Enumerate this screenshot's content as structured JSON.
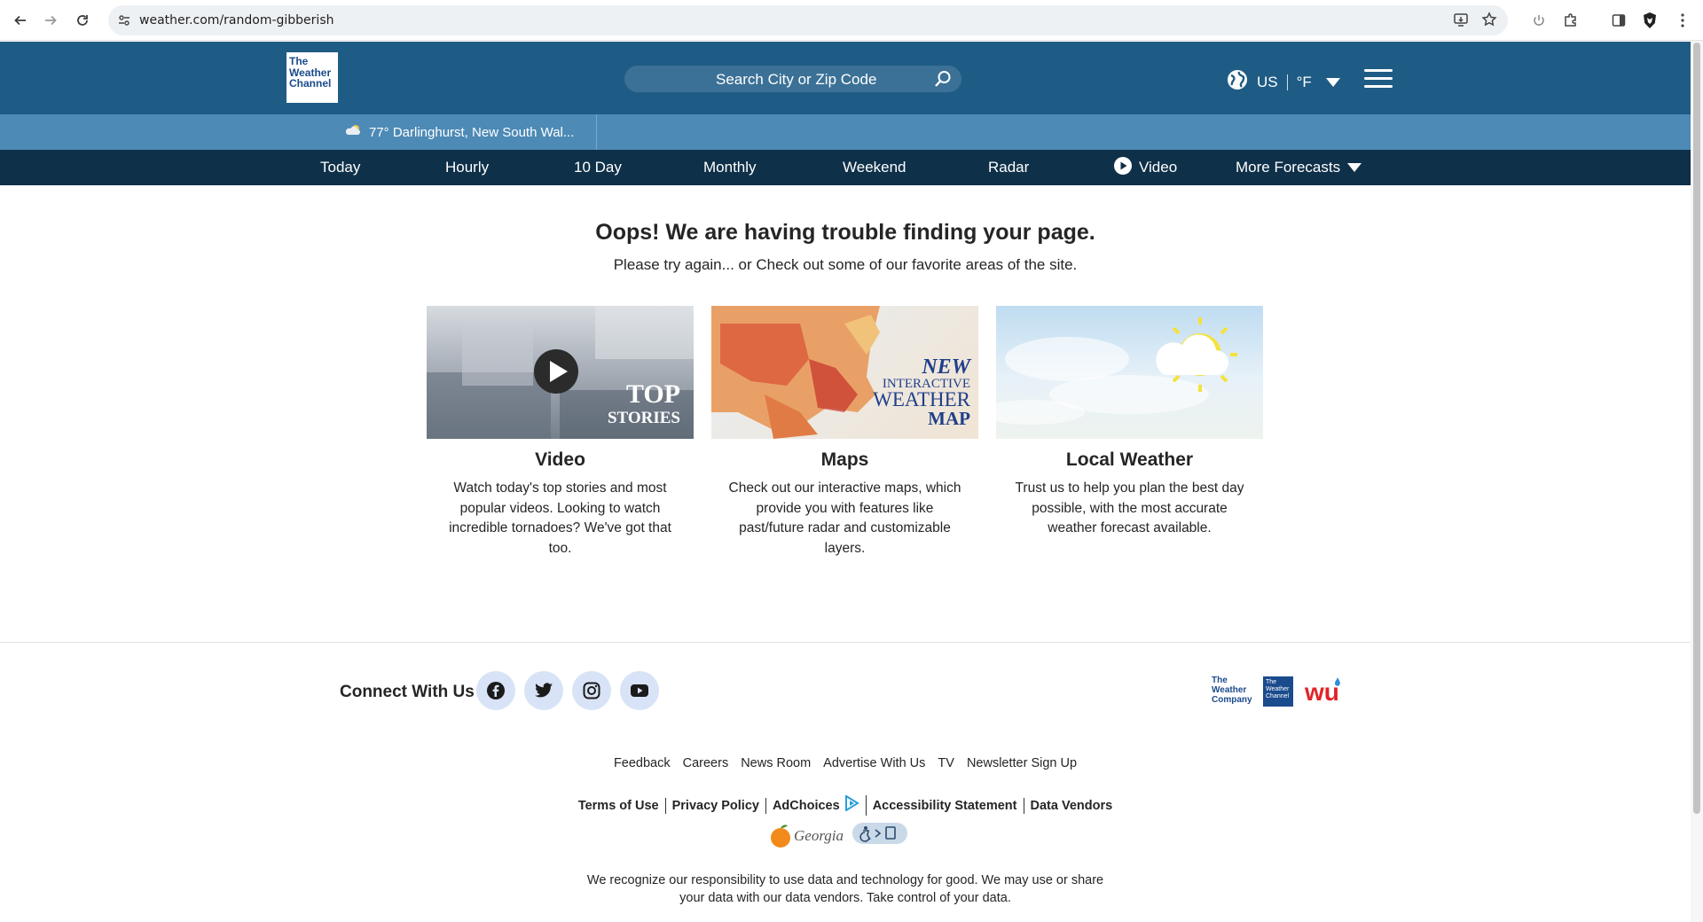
{
  "browser": {
    "url": "weather.com/random-gibberish",
    "icons": [
      "back-arrow-icon",
      "forward-arrow-icon",
      "reload-icon",
      "site-settings-icon",
      "install-app-icon",
      "bookmark-star-icon",
      "power-icon",
      "extensions-icon",
      "sidebar-icon",
      "brave-shield-icon",
      "more-vert-icon"
    ]
  },
  "header": {
    "logo_text": "The Weather Channel",
    "search_placeholder": "Search City or Zip Code",
    "locale_country": "US",
    "locale_unit": "°F"
  },
  "location_bar": {
    "text": "77° Darlinghurst, New South Wal..."
  },
  "nav": {
    "items": [
      "Today",
      "Hourly",
      "10 Day",
      "Monthly",
      "Weekend",
      "Radar",
      "Video",
      "More Forecasts"
    ]
  },
  "error": {
    "title": "Oops! We are having trouble finding your page.",
    "subtitle": "Please try again... or Check out some of our favorite areas of the site."
  },
  "cards": [
    {
      "title": "Video",
      "desc": "Watch today's top stories and most popular videos. Looking to watch incredible tornadoes? We've got that too.",
      "overlay_line1": "TOP",
      "overlay_line2": "STORIES"
    },
    {
      "title": "Maps",
      "desc": "Check out our interactive maps, which provide you with features like past/future radar and customizable layers.",
      "overlay_line1": "NEW",
      "overlay_line2": "INTERACTIVE",
      "overlay_line3": "WEATHER",
      "overlay_line4": "MAP"
    },
    {
      "title": "Local Weather",
      "desc": "Trust us to help you plan the best day possible, with the most accurate weather forecast available."
    }
  ],
  "footer": {
    "connect_label": "Connect With Us",
    "social": [
      "facebook-icon",
      "twitter-icon",
      "instagram-icon",
      "youtube-icon"
    ],
    "links": [
      "Feedback",
      "Careers",
      "News Room",
      "Advertise With Us",
      "TV",
      "Newsletter Sign Up"
    ],
    "legal": [
      "Terms of Use",
      "Privacy Policy",
      "AdChoices",
      "Accessibility Statement",
      "Data Vendors"
    ],
    "georgia_label": "Georgia",
    "notice": "We recognize our responsibility to use data and technology for good. We may use or share your data with our data vendors. Take control of your data.",
    "brand_logos": {
      "twc_company": "The Weather Company",
      "twc": "The Weather Channel",
      "wu": "wu"
    }
  },
  "colors": {
    "header": "#1f5c85",
    "location_bar": "#4d8ab5",
    "nav": "#0f3049",
    "social_bg": "#d9e3f7"
  }
}
